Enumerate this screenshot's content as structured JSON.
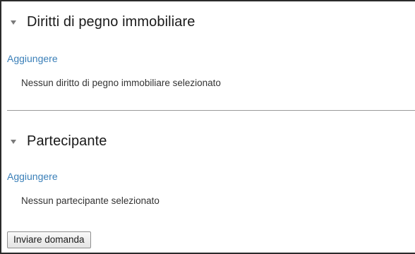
{
  "sections": [
    {
      "title": "Diritti di pegno immobiliare",
      "add_label": "Aggiungere",
      "empty_text": "Nessun diritto di pegno immobiliare selezionato",
      "toggle_icon": "collapse-triangle-icon"
    },
    {
      "title": "Partecipante",
      "add_label": "Aggiungere",
      "empty_text": "Nessun partecipante selezionato",
      "toggle_icon": "collapse-triangle-icon"
    }
  ],
  "actions": {
    "submit_label": "Inviare domanda"
  },
  "colors": {
    "link": "#3a7fb8",
    "text": "#1a1a1a",
    "divider": "#9a9a9a"
  }
}
